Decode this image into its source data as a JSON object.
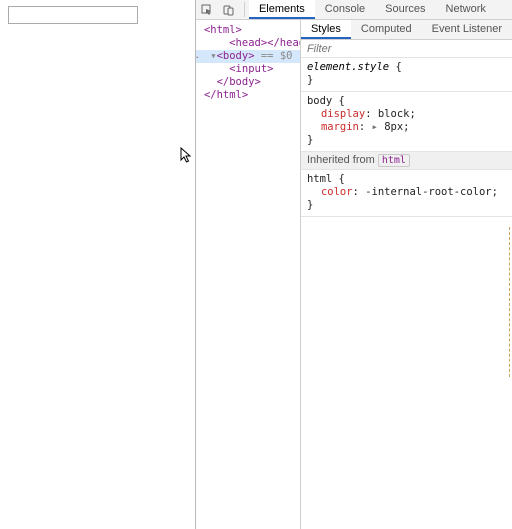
{
  "page": {
    "input_value": ""
  },
  "tabs": {
    "elements": "Elements",
    "console": "Console",
    "sources": "Sources",
    "network": "Network"
  },
  "subtabs": {
    "styles": "Styles",
    "computed": "Computed",
    "eventlisteners": "Event Listener"
  },
  "dom": {
    "l0": "<html>",
    "l1": "  <head></head>",
    "l2_pre": "▾",
    "l2_tag": "<body>",
    "l2_eq": " == $0",
    "l3": "    <input>",
    "l4": "  </body>",
    "l5": "</html>"
  },
  "styles": {
    "filter_placeholder": "Filter",
    "rule1_sel": "element.style",
    "rule2_sel": "body",
    "rule2_p1_n": "display",
    "rule2_p1_v": "block",
    "rule2_p2_n": "margin",
    "rule2_p2_v": "8px",
    "inherited_label": "Inherited from",
    "inherited_tag": "html",
    "rule3_sel": "html",
    "rule3_p1_n": "color",
    "rule3_p1_v": "-internal-root-color"
  }
}
